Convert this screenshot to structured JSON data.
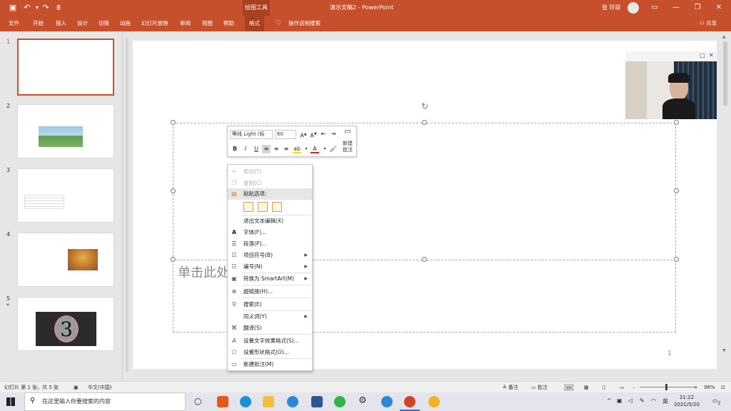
{
  "titlebar": {
    "context_tab_group": "绘图工具",
    "document_title": "演示文稿2  -  PowerPoint",
    "user_name": "张 玲琼"
  },
  "ribbon_tabs": [
    {
      "label": "文件"
    },
    {
      "label": "开始"
    },
    {
      "label": "插入"
    },
    {
      "label": "设计"
    },
    {
      "label": "切换"
    },
    {
      "label": "动画"
    },
    {
      "label": "幻灯片放映"
    },
    {
      "label": "审阅"
    },
    {
      "label": "视图"
    },
    {
      "label": "帮助"
    },
    {
      "label": "格式",
      "active": true
    },
    {
      "label": "操作说明搜索"
    }
  ],
  "share_label": "共享",
  "slides": [
    {
      "number": "1",
      "active": true
    },
    {
      "number": "2"
    },
    {
      "number": "3"
    },
    {
      "number": "4"
    },
    {
      "number": "5",
      "has_animation_marker": true,
      "marker": "*",
      "countdown": "3"
    }
  ],
  "canvas": {
    "placeholder_text": "单击此处",
    "page_number": "1"
  },
  "mini_toolbar": {
    "font_name": "等线 Light (标",
    "font_size": "60",
    "new_comment_line1": "新建",
    "new_comment_line2": "批注",
    "buttons": [
      "B",
      "I",
      "U"
    ]
  },
  "context_menu": {
    "items": [
      {
        "label": "剪切(T)",
        "disabled": true,
        "icon": "cut-icon"
      },
      {
        "label": "复制(C)",
        "disabled": true,
        "icon": "copy-icon"
      },
      {
        "label": "粘贴选项:",
        "highlighted": true,
        "icon": "paste-icon"
      },
      {
        "label": "退出文本编辑(X)"
      },
      {
        "label": "字体(F)...",
        "icon": "font-icon"
      },
      {
        "label": "段落(P)...",
        "icon": "paragraph-icon"
      },
      {
        "label": "项目符号(B)",
        "submenu": true,
        "icon": "bullets-icon"
      },
      {
        "label": "编号(N)",
        "submenu": true,
        "icon": "numbering-icon"
      },
      {
        "label": "转换为 SmartArt(M)",
        "submenu": true,
        "icon": "smartart-icon"
      },
      {
        "label": "超链接(H)...",
        "icon": "hyperlink-icon"
      },
      {
        "label": "搜索(E)",
        "icon": "search-icon"
      },
      {
        "label": "同义词(Y)",
        "submenu": true
      },
      {
        "label": "翻译(S)",
        "icon": "translate-icon"
      },
      {
        "label": "设置文字效果格式(S)...",
        "icon": "text-effects-icon"
      },
      {
        "label": "设置形状格式(O)...",
        "icon": "shape-format-icon"
      },
      {
        "label": "新建批注(M)",
        "icon": "comment-icon"
      }
    ]
  },
  "status_bar": {
    "slide_info": "幻灯片 第 1 张，共 5 张",
    "language": "中文(中国)",
    "notes_label": "备注",
    "comments_label": "批注",
    "zoom": "96%"
  },
  "taskbar": {
    "search_placeholder": "在这里输入你要搜索的内容",
    "ime": "英",
    "time": "21:22",
    "date": "2021/5/20",
    "notification_count": "2"
  },
  "colors": {
    "accent": "#c6502b",
    "accent_dark": "#a8411f"
  }
}
